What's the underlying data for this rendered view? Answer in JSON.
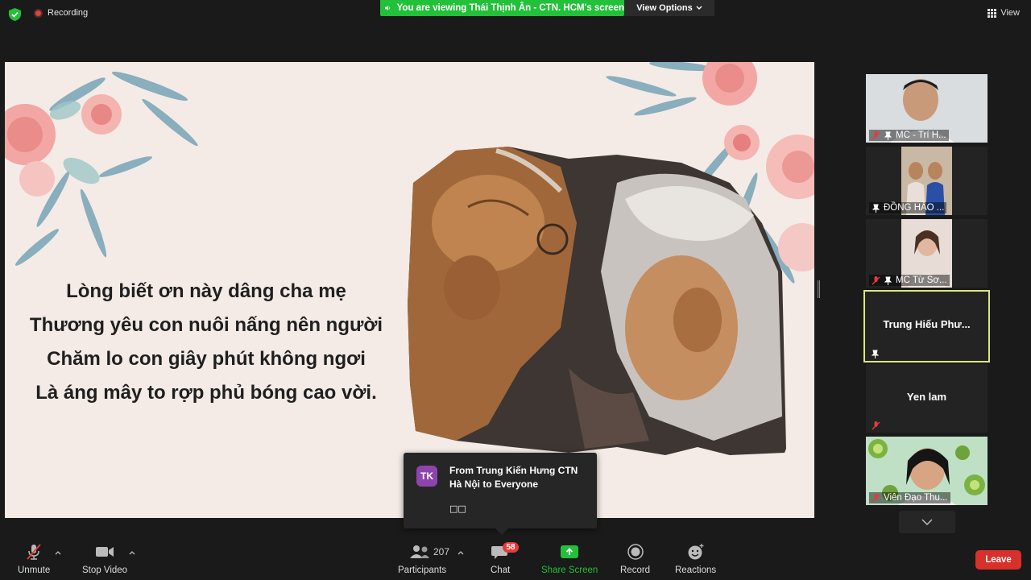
{
  "topbar": {
    "recording_label": "Recording",
    "share_banner": "You are viewing Thái Thịnh Ân - CTN. HCM's screen",
    "view_options_label": "View Options",
    "view_label": "View"
  },
  "slide": {
    "poem_lines": [
      "Lòng biết ơn này dâng cha mẹ",
      "Thương yêu con nuôi nấng nên người",
      "Chăm lo con giây phút không ngơi",
      "Là áng mây to rợp phủ bóng cao vời."
    ]
  },
  "gallery": {
    "tiles": [
      {
        "name": "MC - Trí H..."
      },
      {
        "name": "ĐỒNG HÀO ..."
      },
      {
        "name": "MC Từ Sơ..."
      },
      {
        "name": "Trung  Hiếu  Phư..."
      },
      {
        "name": "Yen lam"
      },
      {
        "name": "Viên Đạo Thu..."
      }
    ]
  },
  "chat_toast": {
    "avatar_initials": "TK",
    "from": "From Trung Kiến Hưng CTN Hà Nội to Everyone",
    "message": "□□"
  },
  "toolbar": {
    "unmute_label": "Unmute",
    "stop_video_label": "Stop Video",
    "participants_label": "Participants",
    "participants_count": "207",
    "chat_label": "Chat",
    "chat_badge": "58",
    "share_screen_label": "Share Screen",
    "record_label": "Record",
    "reactions_label": "Reactions",
    "leave_label": "Leave"
  },
  "colors": {
    "share_green": "#23c03a",
    "leave_red": "#d8302a",
    "active_speaker_border": "#dbe878",
    "avatar_purple": "#8e44ad"
  }
}
